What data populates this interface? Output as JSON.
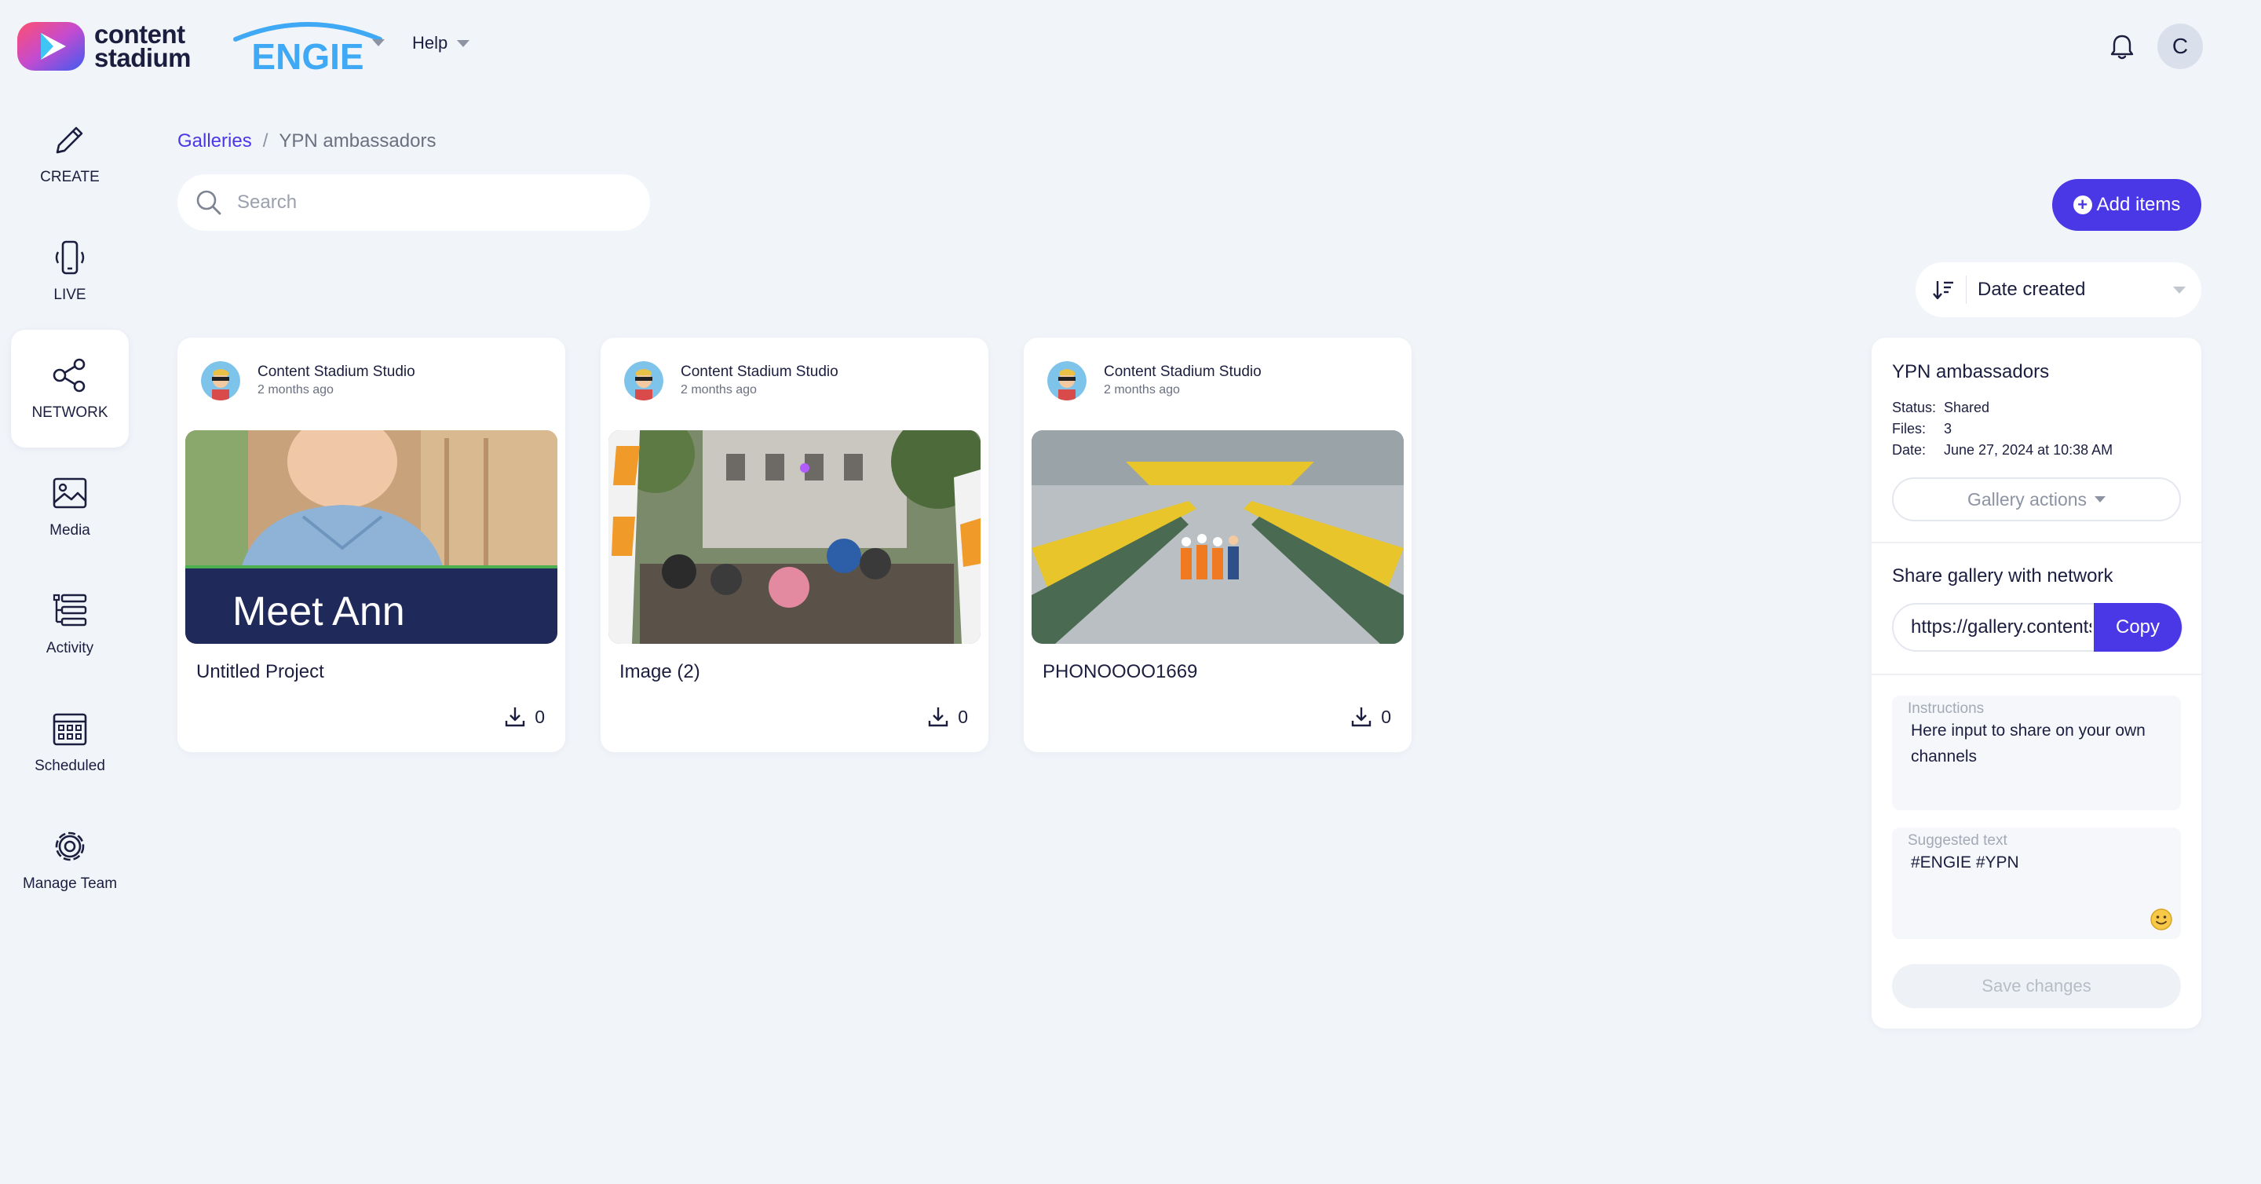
{
  "app": {
    "logo_text_line1": "content",
    "logo_text_line2": "stadium",
    "brand_name": "ENGIE",
    "help_label": "Help",
    "avatar_initial": "C"
  },
  "sidebar": {
    "items": [
      {
        "label": "CREATE",
        "icon": "pencil-icon"
      },
      {
        "label": "LIVE",
        "icon": "phone-icon"
      },
      {
        "label": "NETWORK",
        "icon": "share-icon",
        "active": true
      },
      {
        "label": "Media",
        "icon": "image-icon"
      },
      {
        "label": "Activity",
        "icon": "list-icon"
      },
      {
        "label": "Scheduled",
        "icon": "calendar-icon"
      },
      {
        "label": "Manage Team",
        "icon": "gear-icon"
      }
    ]
  },
  "breadcrumb": {
    "parent": "Galleries",
    "separator": "/",
    "current": "YPN ambassadors"
  },
  "search": {
    "placeholder": "Search",
    "value": ""
  },
  "toolbar": {
    "add_items_label": "Add items",
    "sort_label": "Date created"
  },
  "cards": [
    {
      "author": "Content Stadium Studio",
      "time": "2 months ago",
      "title": "Untitled Project",
      "downloads": "0",
      "thumb_text": "Meet Ann"
    },
    {
      "author": "Content Stadium Studio",
      "time": "2 months ago",
      "title": "Image (2)",
      "downloads": "0"
    },
    {
      "author": "Content Stadium Studio",
      "time": "2 months ago",
      "title": "PHONOOOO1669",
      "downloads": "0"
    }
  ],
  "panel": {
    "title": "YPN ambassadors",
    "status_label": "Status:",
    "status_value": "Shared",
    "files_label": "Files:",
    "files_value": "3",
    "date_label": "Date:",
    "date_value": "June 27, 2024 at 10:38 AM",
    "gallery_actions_label": "Gallery actions",
    "share_title": "Share gallery with network",
    "share_url": "https://gallery.contentstadium.com",
    "copy_label": "Copy",
    "instructions_label": "Instructions",
    "instructions_value": "Here input to share on your own channels",
    "suggested_label": "Suggested text",
    "suggested_value": "#ENGIE #YPN",
    "save_label": "Save changes"
  },
  "colors": {
    "accent": "#4a37e6",
    "background": "#f1f4f9",
    "text": "#1c1e3f",
    "engie_blue": "#3fa9f5"
  }
}
